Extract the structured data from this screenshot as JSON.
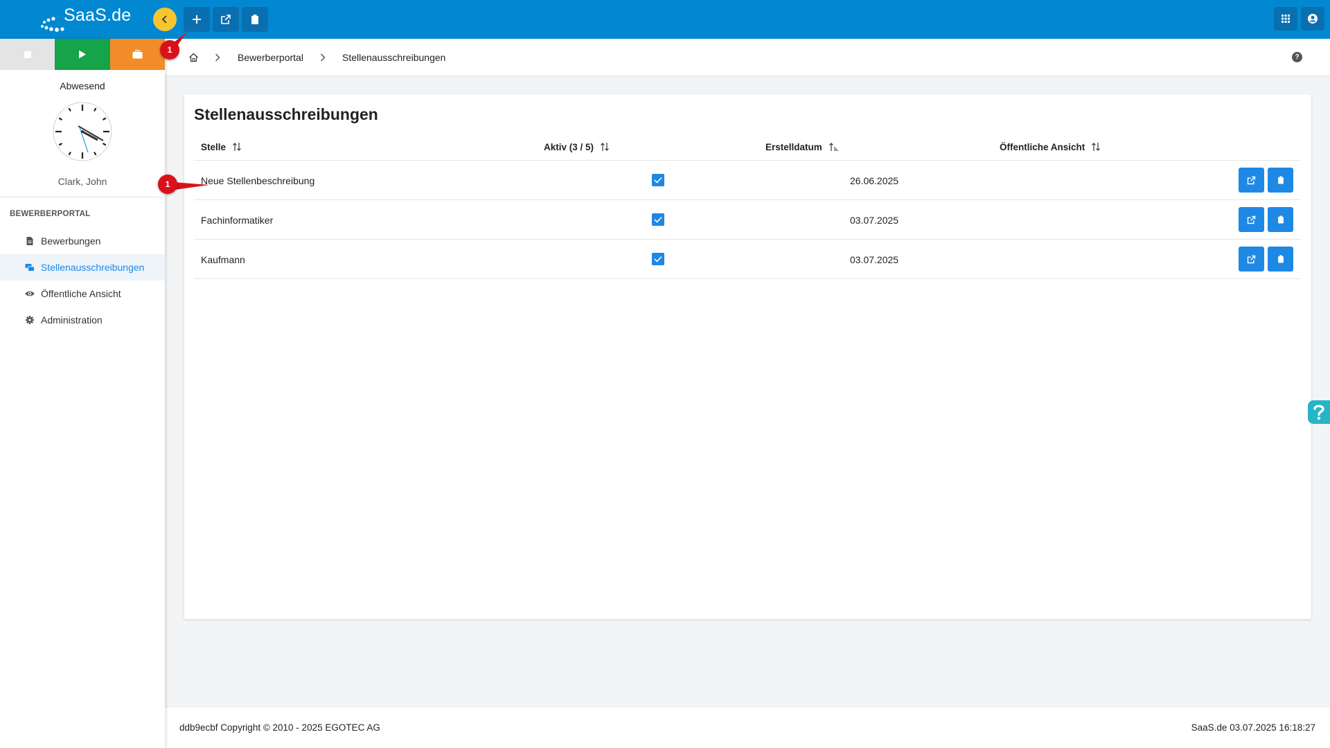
{
  "app": {
    "logo_text": "SaaS.de"
  },
  "annotation": {
    "marker_label": "1"
  },
  "sidebar": {
    "status_label": "Abwesend",
    "user_name": "Clark, John",
    "section_title": "BEWERBERPORTAL",
    "items": [
      {
        "label": "Bewerbungen",
        "icon": "document-icon",
        "active": false
      },
      {
        "label": "Stellenausschreibungen",
        "icon": "job-postings-icon",
        "active": true
      },
      {
        "label": "Öffentliche Ansicht",
        "icon": "eye-icon",
        "active": false
      },
      {
        "label": "Administration",
        "icon": "gear-icon",
        "active": false
      }
    ]
  },
  "breadcrumb": {
    "items": [
      "Bewerberportal",
      "Stellenausschreibungen"
    ]
  },
  "page": {
    "title": "Stellenausschreibungen",
    "columns": {
      "stelle": "Stelle",
      "aktiv": "Aktiv (3 / 5)",
      "erstelldatum": "Erstelldatum",
      "ansicht": "Öffentliche Ansicht"
    },
    "rows": [
      {
        "stelle": "Neue Stellenbeschreibung",
        "aktiv": true,
        "erstelldatum": "26.06.2025"
      },
      {
        "stelle": "Fachinformatiker",
        "aktiv": true,
        "erstelldatum": "03.07.2025"
      },
      {
        "stelle": "Kaufmann",
        "aktiv": true,
        "erstelldatum": "03.07.2025"
      }
    ]
  },
  "footer": {
    "copyright": "ddb9ecbf Copyright © 2010 - 2025 EGOTEC AG",
    "right_text": "SaaS.de 03.07.2025 16:18:27"
  },
  "colors": {
    "topbar": "#0288d1",
    "accent": "#1e88e5",
    "back_button": "#f7c62f",
    "marker": "#d9111a",
    "help_float": "#26b5c6"
  }
}
